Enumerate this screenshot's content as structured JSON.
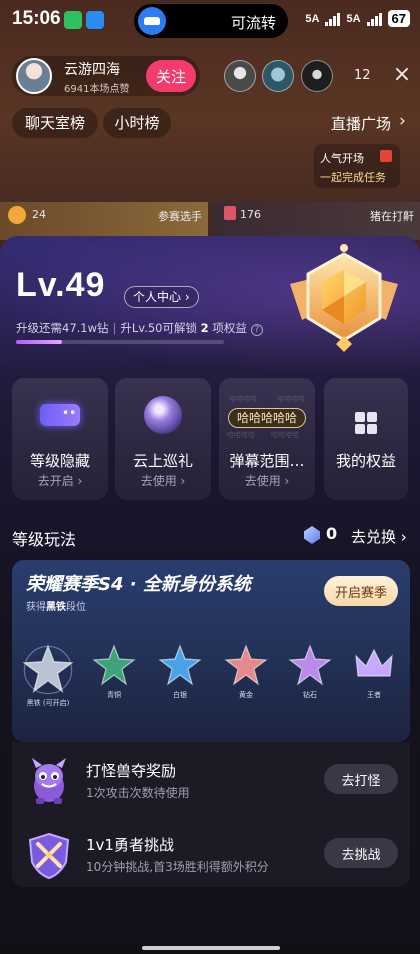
{
  "status_bar": {
    "time": "15:06",
    "island_text": "可流转",
    "network1": "5A",
    "network2": "5A",
    "battery": "67"
  },
  "live_room": {
    "anchor_name": "云游四海",
    "anchor_likes": "6941本场点赞",
    "follow_label": "关注",
    "viewer_count": "12",
    "close_icon": "×",
    "chip_chatroom": "聊天室榜",
    "chip_hour": "小时榜",
    "plaza": "直播广场",
    "plaza_arrow": "›",
    "task_line1": "人气开场",
    "task_line2": "一起完成任务",
    "tile_left_count": "24",
    "tile_left_label": "参赛选手",
    "tile_right_count": "176",
    "tile_right_label": "猪在打鼾"
  },
  "level_panel": {
    "level": "Lv.49",
    "personal_center": "个人中心 ›",
    "upgrade_prefix": "升级还需47.1w钻",
    "upgrade_sep": "|",
    "upgrade_mid": "升Lv.50可解锁",
    "unlock_count": "2",
    "upgrade_suffix": "项权益",
    "help_icon": "?",
    "progress": 0.22
  },
  "cards": [
    {
      "title": "等级隐藏",
      "sub": "去开启 ›",
      "icon": "eye-badge-icon"
    },
    {
      "title": "云上巡礼",
      "sub": "去使用 ›",
      "icon": "globe-icon"
    },
    {
      "title": "弹幕范围…",
      "sub": "去使用 ›",
      "icon": "bullet-comment-icon",
      "badge": "哈哈哈哈哈",
      "ghost": "哈哈哈哈"
    },
    {
      "title": "我的权益",
      "sub": "",
      "icon": "grid-icon"
    }
  ],
  "level_play": {
    "title": "等级玩法",
    "points": "0",
    "exchange": "去兑换 ›"
  },
  "season": {
    "title": "荣耀赛季S4 · 全新身份系统",
    "sub_prefix": "获得",
    "sub_bold": "黑铁",
    "sub_suffix": "段位",
    "button": "开启赛季",
    "ranks": [
      {
        "label": "黑铁 (可开启)",
        "color": "#b9c2d6"
      },
      {
        "label": "青铜",
        "color": "#3fa37a"
      },
      {
        "label": "白银",
        "color": "#4aa3e8"
      },
      {
        "label": "黄金",
        "color": "#e48a8a"
      },
      {
        "label": "钻石",
        "color": "#b98ae8"
      },
      {
        "label": "王者",
        "color": "#c7a8ff"
      }
    ]
  },
  "rewards": [
    {
      "title": "打怪兽夺奖励",
      "sub": "1次攻击次数待使用",
      "button": "去打怪",
      "icon": "monster-icon"
    },
    {
      "title": "1v1勇者挑战",
      "sub": "10分钟挑战,首3场胜利得额外积分",
      "button": "去挑战",
      "icon": "crossed-swords-shield-icon"
    }
  ]
}
